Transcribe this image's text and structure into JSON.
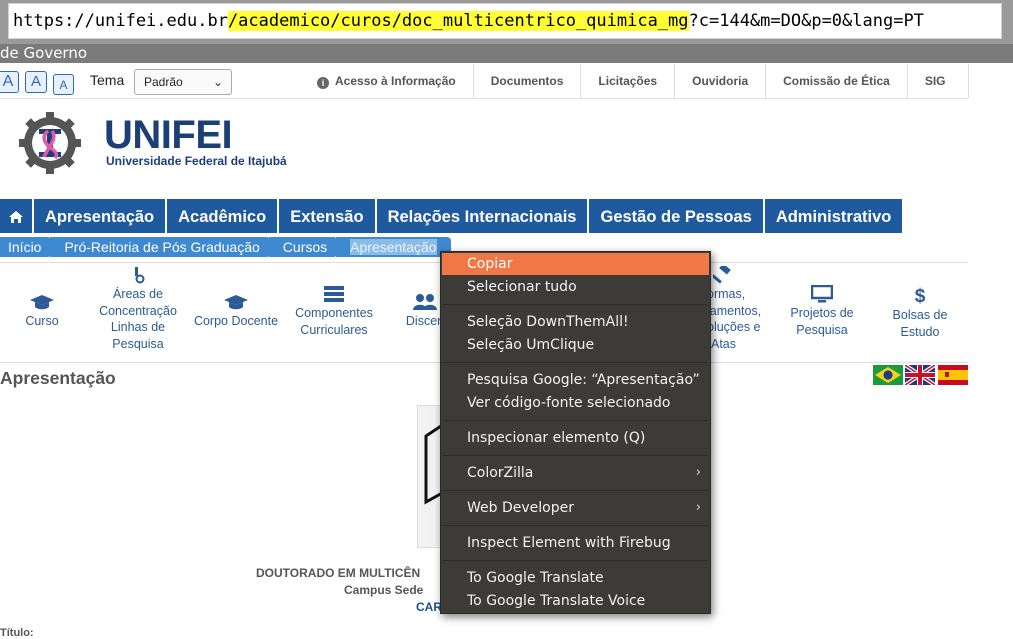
{
  "browser": {
    "url_base": "https://unifei.edu.br",
    "url_path": "/academico/curos/doc_multicentrico_quimica_mg",
    "url_query": "?c=144&m=DO&p=0&lang=PT"
  },
  "govbar": {
    "text": "de Governo"
  },
  "accessibility": {
    "font_buttons": [
      "A",
      "A",
      "A"
    ],
    "theme_label": "Tema",
    "theme_value": "Padrão"
  },
  "topnav": {
    "items": [
      "Acesso à Informação",
      "Documentos",
      "Licitações",
      "Ouvidoria",
      "Comissão de Ética",
      "SIG"
    ]
  },
  "logo": {
    "title": "UNIFEI",
    "subtitle": "Universidade Federal de Itajubá"
  },
  "mainnav": {
    "items": [
      "Apresentação",
      "Acadêmico",
      "Extensão",
      "Relações Internacionais",
      "Gestão de Pessoas",
      "Administrativo"
    ]
  },
  "breadcrumb": {
    "items": [
      "Início",
      "Pró-Reitoria de Pós Graduação",
      "Cursos",
      "Apresentação"
    ]
  },
  "iconmenu": {
    "curso": "Curso",
    "areas_1": "Áreas de",
    "areas_2": "Concentração",
    "areas_3": "Linhas de",
    "areas_4": "Pesquisa",
    "corpo": "Corpo Docente",
    "comp_1": "Componentes",
    "comp_2": "Curriculares",
    "disc": "Discen",
    "normas_1": "ormas,",
    "normas_2": "lamentos,",
    "normas_3": "oluções e",
    "normas_4": "Atas",
    "proj_1": "Projetos de",
    "proj_2": "Pesquisa",
    "bolsas_1": "Bolsas de",
    "bolsas_2": "Estudo"
  },
  "section": {
    "title": "Apresentação"
  },
  "content": {
    "line1": "DOUTORADO EM MULTICÊN",
    "line2": "Campus Sede",
    "line3": "CAR",
    "line4": "Título:"
  },
  "context_menu": {
    "items": {
      "copy": "Copiar",
      "select_all": "Selecionar tudo",
      "dta": "Seleção DownThemAll!",
      "umclique": "Seleção UmClique",
      "google": "Pesquisa Google: “Apresentação”",
      "view_source": "Ver código-fonte selecionado",
      "inspect": "Inspecionar elemento (Q)",
      "colorzilla": "ColorZilla",
      "webdev": "Web Developer",
      "firebug": "Inspect Element with Firebug",
      "translate": "To Google Translate",
      "translate_voice": "To Google Translate Voice"
    },
    "highlight_color": "#f07746",
    "background_color": "#3c3b37"
  },
  "colors": {
    "nav_blue": "#1f5a9e",
    "breadcrumb_blue": "#3f89d0",
    "url_highlight": "#ffff33"
  }
}
